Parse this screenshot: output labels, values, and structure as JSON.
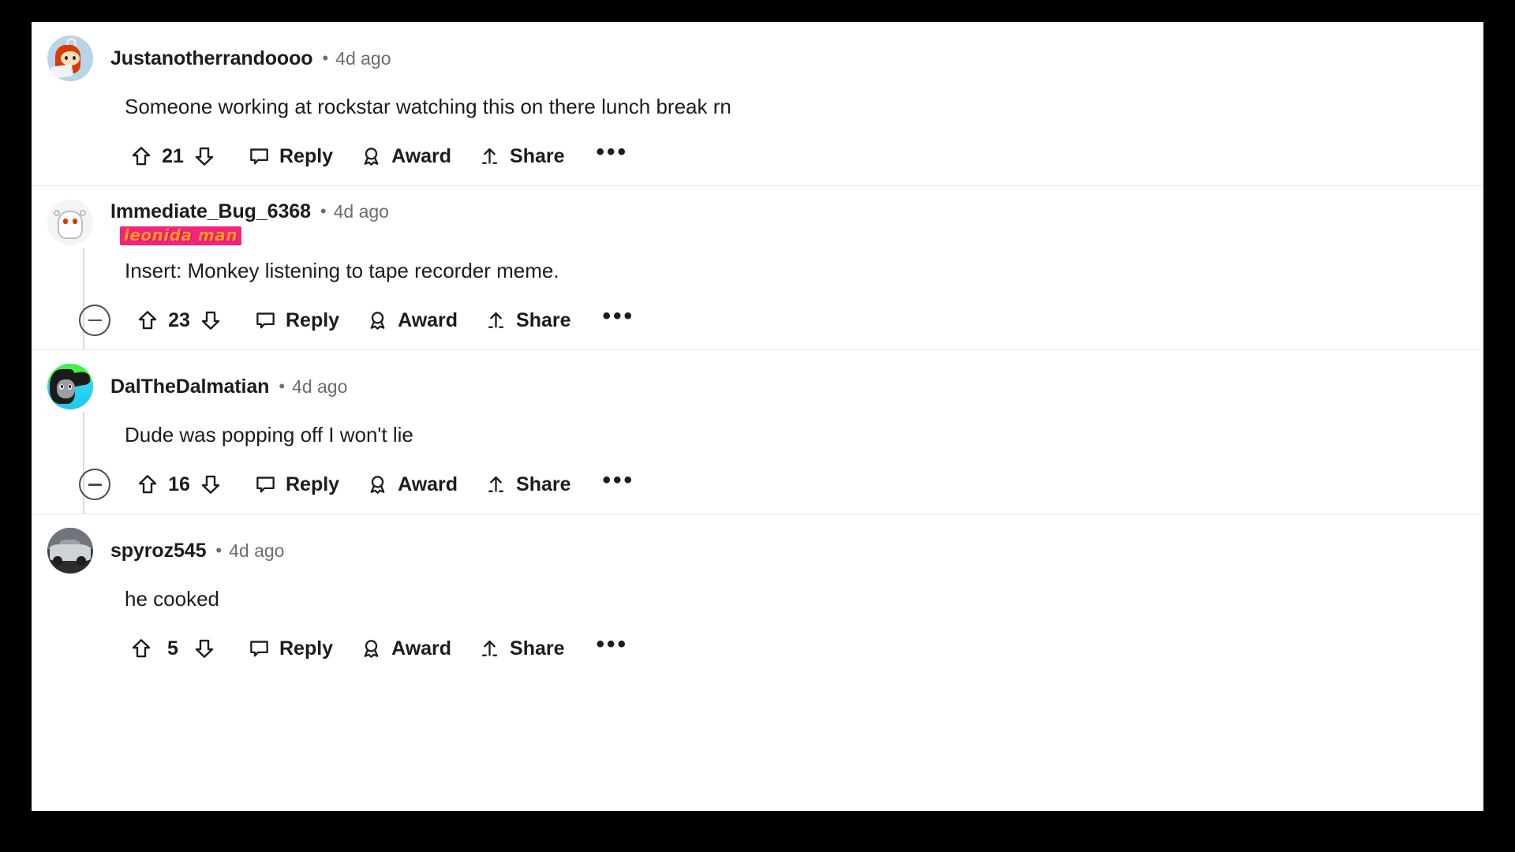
{
  "theme": {
    "page_background": "#000000",
    "card_background": "#ffffff",
    "text_primary": "#1c1c1c",
    "text_muted": "#6a6d6f",
    "divider": "#e2e4e6",
    "thread_line": "#d8dadc",
    "flair_background": "#f4237e",
    "flair_text": "#ff9a1f"
  },
  "labels": {
    "reply": "Reply",
    "award": "Award",
    "share": "Share",
    "more": "•••",
    "separator": "•"
  },
  "comments": [
    {
      "username": "Justanotherrandoooo",
      "timestamp": "4d ago",
      "flair": null,
      "text": "Someone working at rockstar watching this on there lunch break rn",
      "score": "21",
      "has_collapse": false,
      "avatar": "snoo-red-avatar"
    },
    {
      "username": "Immediate_Bug_6368",
      "timestamp": "4d ago",
      "flair": "Leonida man",
      "text": "Insert: Monkey listening to tape recorder meme.",
      "score": "23",
      "has_collapse": true,
      "avatar": "snoo-grey-avatar"
    },
    {
      "username": "DalTheDalmatian",
      "timestamp": "4d ago",
      "flair": null,
      "text": "Dude was popping off I won't lie",
      "score": "16",
      "has_collapse": true,
      "avatar": "dalmatian-avatar"
    },
    {
      "username": "spyroz545",
      "timestamp": "4d ago",
      "flair": null,
      "text": "he cooked",
      "score": "5",
      "has_collapse": false,
      "avatar": "car-photo-avatar"
    }
  ]
}
